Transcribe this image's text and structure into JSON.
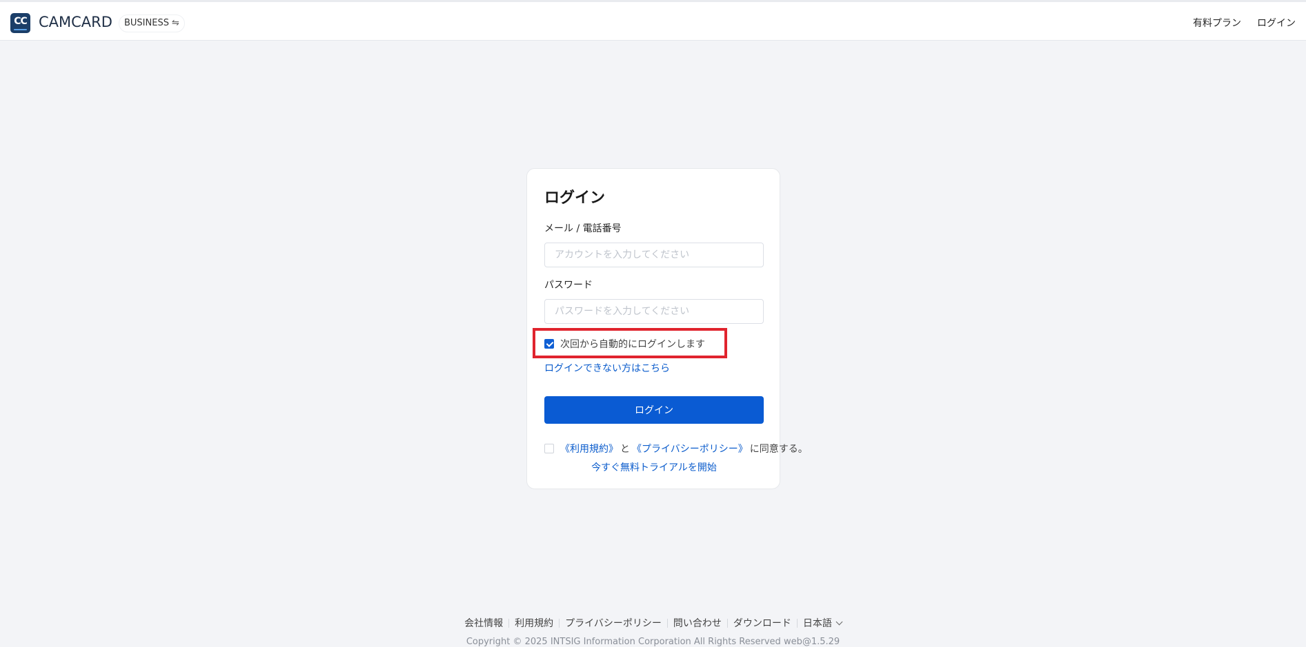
{
  "header": {
    "logo_text": "CC",
    "brand": "CAMCARD",
    "edition": "BUSINESS",
    "swap_symbol": "⇋",
    "nav": [
      "有料プラン",
      "ログイン"
    ]
  },
  "login_card": {
    "title": "ログイン",
    "account_label": "メール / 電話番号",
    "account_placeholder": "アカウントを入力してください",
    "password_label": "パスワード",
    "password_placeholder": "パスワードを入力してください",
    "remember_label": "次回から自動的にログインします",
    "remember_checked": true,
    "forgot_link": "ログインできない方はこちら",
    "login_button": "ログイン",
    "agree": {
      "checked": false,
      "terms": "《利用規約》",
      "and": "と",
      "privacy": "《プライバシーポリシー》",
      "suffix": "に同意する。"
    },
    "trial_link": "今すぐ無料トライアルを開始"
  },
  "footer": {
    "links": [
      "会社情報",
      "利用規約",
      "プライバシーポリシー",
      "問い合わせ",
      "ダウンロード"
    ],
    "language": "日本語",
    "copyright": "Copyright © 2025 INTSIG Information Corporation All Rights Reserved web@1.5.29"
  },
  "colors": {
    "primary": "#0a5bd3",
    "highlight_box": "#e0242e",
    "background": "#f3f4f7"
  }
}
